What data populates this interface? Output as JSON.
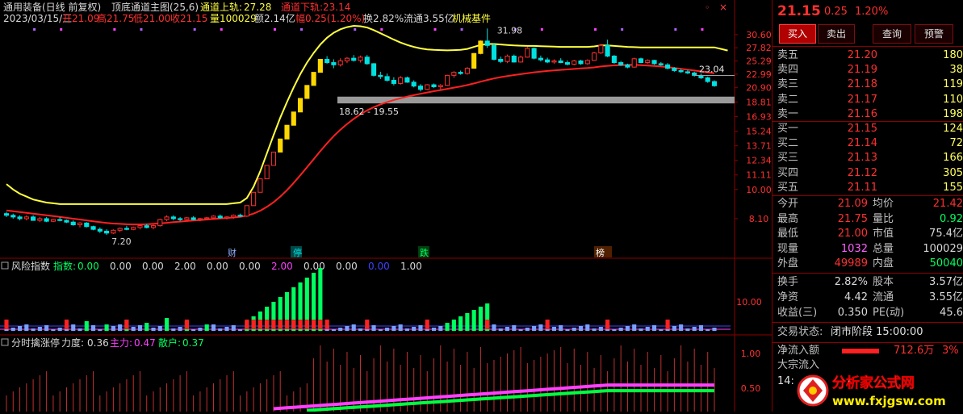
{
  "header": {
    "name": "通用装备(日线 前复权)",
    "indicator": "顶底通道主图(25,6)",
    "upper_label": "通道上轨:",
    "upper_val": "27.28",
    "lower_label": "通道下轨:",
    "lower_val": "23.14",
    "line2_date": "2023/03/15/三",
    "line2_open": "开21.09",
    "line2_high": "高21.75",
    "line2_low": "低21.00",
    "line2_close": "收21.15",
    "line2_vol": "量100029",
    "line2_amt": "额2.14亿",
    "line2_chg": "幅0.25(1.20%)",
    "line2_turn": "换2.82%",
    "line2_float": "流通3.55亿",
    "line2_sector": "机械基件"
  },
  "panel2": {
    "title": "风险指数",
    "idx_label": "指数:",
    "values": [
      "0.00",
      "0.00",
      "0.00",
      "2.00",
      "0.00",
      "0.00",
      "2.00",
      "0.00",
      "0.00",
      "0.00",
      "1.00"
    ],
    "axis_label": "10.00"
  },
  "panel3": {
    "title": "分时擒涨停",
    "force_label": "力度:",
    "force_val": "0.36",
    "main_label": "主力:",
    "main_val": "0.47",
    "retail_label": "散户:",
    "retail_val": "0.37",
    "axis": [
      "1.00",
      "0.50"
    ]
  },
  "chart_data": {
    "type": "candlestick",
    "y_axis_ticks": [
      "30.60",
      "27.82",
      "25.29",
      "22.99",
      "20.90",
      "18.81",
      "16.93",
      "15.24",
      "13.71",
      "12.34",
      "11.11",
      "10.00",
      "8.10"
    ],
    "annotations": {
      "peak": "31.98",
      "low": "7.20",
      "band": "18.62 - 19.55",
      "last": "23.04"
    },
    "markers": [
      "财",
      "停",
      "跌",
      "榜"
    ],
    "colors": {
      "up": "#ff3030",
      "down": "#00e0e0",
      "upper_channel": "#ffff40",
      "lower_channel": "#ff2020",
      "band": "#9a9a9a"
    },
    "candles": [
      [
        8.4,
        8.5,
        8.2,
        8.3
      ],
      [
        8.3,
        8.4,
        8.1,
        8.2
      ],
      [
        8.2,
        8.3,
        8.0,
        8.1
      ],
      [
        8.1,
        8.3,
        8.0,
        8.2
      ],
      [
        8.2,
        8.3,
        8.0,
        8.0
      ],
      [
        8.0,
        8.2,
        7.9,
        8.1
      ],
      [
        8.1,
        8.2,
        7.9,
        7.95
      ],
      [
        7.95,
        8.1,
        7.9,
        8.05
      ],
      [
        8.05,
        8.2,
        7.95,
        8.0
      ],
      [
        8.0,
        8.05,
        7.85,
        7.9
      ],
      [
        7.9,
        8.0,
        7.7,
        7.75
      ],
      [
        7.75,
        7.9,
        7.6,
        7.85
      ],
      [
        7.85,
        7.9,
        7.6,
        7.65
      ],
      [
        7.65,
        7.7,
        7.45,
        7.5
      ],
      [
        7.5,
        7.6,
        7.3,
        7.4
      ],
      [
        7.4,
        7.5,
        7.2,
        7.3
      ],
      [
        7.3,
        7.5,
        7.25,
        7.45
      ],
      [
        7.45,
        7.6,
        7.35,
        7.55
      ],
      [
        7.55,
        7.7,
        7.45,
        7.5
      ],
      [
        7.5,
        7.65,
        7.45,
        7.6
      ],
      [
        7.6,
        7.75,
        7.5,
        7.7
      ],
      [
        7.7,
        7.8,
        7.55,
        7.6
      ],
      [
        7.6,
        7.75,
        7.5,
        7.7
      ],
      [
        7.7,
        8.1,
        7.65,
        8.05
      ],
      [
        8.05,
        8.3,
        7.95,
        8.2
      ],
      [
        8.2,
        8.3,
        8.0,
        8.1
      ],
      [
        8.1,
        8.2,
        7.95,
        8.05
      ],
      [
        8.05,
        8.2,
        8.0,
        8.15
      ],
      [
        8.15,
        8.25,
        8.0,
        8.05
      ],
      [
        8.05,
        8.15,
        7.95,
        8.1
      ],
      [
        8.1,
        8.2,
        8.0,
        8.15
      ],
      [
        8.15,
        8.3,
        8.1,
        8.25
      ],
      [
        8.25,
        8.35,
        8.1,
        8.15
      ],
      [
        8.15,
        8.25,
        8.05,
        8.2
      ],
      [
        8.2,
        8.35,
        8.1,
        8.3
      ],
      [
        8.3,
        8.4,
        8.2,
        8.25
      ],
      [
        8.25,
        8.9,
        8.2,
        8.9
      ],
      [
        8.9,
        9.8,
        8.9,
        9.8
      ],
      [
        9.8,
        10.8,
        9.8,
        10.8
      ],
      [
        10.8,
        11.9,
        10.8,
        11.9
      ],
      [
        11.9,
        13.1,
        11.9,
        13.1
      ],
      [
        13.1,
        14.4,
        13.1,
        14.4
      ],
      [
        14.4,
        15.9,
        14.4,
        15.9
      ],
      [
        15.9,
        17.5,
        15.9,
        17.5
      ],
      [
        17.5,
        19.3,
        17.5,
        19.3
      ],
      [
        19.3,
        21.2,
        19.3,
        21.2
      ],
      [
        21.2,
        23.3,
        21.2,
        23.3
      ],
      [
        23.3,
        25.6,
        23.3,
        25.6
      ],
      [
        25.6,
        26.2,
        24.8,
        25.0
      ],
      [
        25.0,
        25.6,
        24.0,
        24.6
      ],
      [
        24.6,
        25.8,
        24.3,
        25.3
      ],
      [
        25.3,
        26.0,
        24.9,
        25.8
      ],
      [
        25.8,
        26.4,
        25.2,
        25.4
      ],
      [
        25.4,
        26.3,
        25.0,
        26.0
      ],
      [
        26.0,
        26.4,
        24.6,
        24.8
      ],
      [
        24.8,
        24.9,
        22.6,
        22.8
      ],
      [
        22.8,
        23.4,
        22.2,
        22.6
      ],
      [
        22.6,
        23.1,
        21.8,
        22.0
      ],
      [
        22.0,
        22.5,
        21.2,
        21.5
      ],
      [
        21.5,
        22.7,
        21.3,
        22.4
      ],
      [
        22.4,
        22.6,
        21.6,
        21.7
      ],
      [
        21.7,
        22.0,
        20.9,
        21.1
      ],
      [
        21.1,
        21.4,
        20.3,
        20.6
      ],
      [
        20.6,
        21.4,
        20.5,
        21.3
      ],
      [
        21.3,
        21.5,
        20.8,
        21.0
      ],
      [
        21.0,
        21.4,
        20.6,
        21.2
      ],
      [
        21.2,
        22.9,
        21.1,
        22.8
      ],
      [
        22.8,
        23.5,
        22.4,
        23.3
      ],
      [
        23.3,
        23.6,
        22.9,
        23.1
      ],
      [
        23.1,
        24.2,
        22.9,
        24.0
      ],
      [
        24.0,
        26.8,
        23.9,
        26.7
      ],
      [
        26.7,
        29.4,
        26.5,
        29.2
      ],
      [
        29.2,
        31.98,
        27.8,
        28.3
      ],
      [
        28.3,
        28.8,
        25.4,
        25.6
      ],
      [
        25.6,
        26.1,
        24.9,
        25.2
      ],
      [
        25.2,
        26.5,
        24.9,
        26.2
      ],
      [
        26.2,
        26.5,
        25.0,
        25.1
      ],
      [
        25.1,
        26.3,
        25.0,
        26.0
      ],
      [
        26.0,
        28.0,
        25.9,
        27.7
      ],
      [
        27.7,
        27.9,
        25.6,
        25.8
      ],
      [
        25.8,
        26.3,
        25.2,
        25.5
      ],
      [
        25.5,
        25.9,
        24.9,
        25.1
      ],
      [
        25.1,
        25.6,
        24.8,
        25.3
      ],
      [
        25.3,
        25.8,
        24.9,
        25.0
      ],
      [
        25.0,
        25.4,
        24.5,
        24.7
      ],
      [
        24.7,
        25.5,
        24.5,
        25.3
      ],
      [
        25.3,
        25.5,
        24.6,
        24.8
      ],
      [
        24.8,
        25.6,
        24.6,
        25.4
      ],
      [
        25.4,
        27.0,
        25.3,
        26.8
      ],
      [
        26.8,
        28.6,
        26.6,
        28.3
      ],
      [
        28.3,
        29.5,
        26.0,
        26.2
      ],
      [
        26.2,
        26.4,
        24.8,
        25.0
      ],
      [
        25.0,
        25.3,
        24.4,
        24.6
      ],
      [
        24.6,
        24.8,
        24.0,
        24.2
      ],
      [
        24.2,
        25.9,
        24.1,
        25.7
      ],
      [
        25.7,
        25.9,
        24.9,
        25.0
      ],
      [
        25.0,
        25.6,
        24.8,
        25.4
      ],
      [
        25.4,
        25.5,
        24.6,
        24.8
      ],
      [
        24.8,
        25.1,
        24.4,
        24.6
      ],
      [
        24.6,
        24.9,
        23.8,
        24.0
      ],
      [
        24.0,
        24.2,
        23.4,
        23.6
      ],
      [
        23.6,
        23.9,
        23.2,
        23.4
      ],
      [
        23.4,
        23.7,
        23.0,
        23.2
      ],
      [
        23.2,
        23.4,
        22.6,
        22.8
      ],
      [
        22.8,
        23.1,
        22.2,
        22.4
      ],
      [
        22.4,
        22.6,
        21.6,
        21.8
      ],
      [
        21.8,
        22.0,
        21.0,
        21.15
      ]
    ],
    "upper_channel": [
      10.4,
      10.0,
      9.7,
      9.5,
      9.3,
      9.2,
      9.1,
      9.05,
      9.0,
      9.0,
      9.0,
      9.0,
      9.0,
      9.0,
      9.0,
      9.0,
      9.0,
      9.0,
      9.0,
      9.0,
      9.0,
      9.0,
      9.0,
      9.0,
      9.0,
      9.0,
      9.0,
      9.0,
      9.0,
      9.0,
      9.0,
      9.0,
      9.0,
      9.0,
      9.05,
      9.1,
      9.4,
      10.2,
      11.4,
      13.0,
      14.8,
      16.8,
      18.8,
      20.9,
      23.0,
      25.0,
      26.8,
      28.5,
      29.9,
      31.0,
      31.8,
      32.3,
      32.6,
      32.5,
      32.2,
      31.6,
      30.9,
      30.2,
      29.5,
      28.9,
      28.4,
      28.0,
      27.7,
      27.5,
      27.4,
      27.35,
      27.3,
      27.35,
      27.4,
      27.6,
      28.0,
      28.4,
      28.6,
      28.6,
      28.5,
      28.4,
      28.3,
      28.25,
      28.2,
      28.2,
      28.15,
      28.1,
      28.05,
      28.0,
      28.0,
      28.0,
      28.0,
      28.0,
      28.1,
      28.3,
      28.3,
      28.2,
      28.1,
      28.0,
      27.95,
      27.9,
      27.9,
      27.9,
      27.9,
      27.9,
      27.9,
      27.9,
      27.9,
      27.9,
      27.9,
      27.9,
      27.9,
      27.6,
      27.28
    ],
    "lower_channel": [
      8.6,
      8.55,
      8.5,
      8.45,
      8.4,
      8.35,
      8.3,
      8.25,
      8.2,
      8.15,
      8.1,
      8.05,
      8.0,
      7.95,
      7.9,
      7.85,
      7.82,
      7.8,
      7.78,
      7.77,
      7.77,
      7.78,
      7.8,
      7.83,
      7.86,
      7.9,
      7.93,
      7.96,
      7.99,
      8.02,
      8.05,
      8.08,
      8.11,
      8.14,
      8.17,
      8.2,
      8.28,
      8.4,
      8.58,
      8.82,
      9.12,
      9.5,
      9.95,
      10.48,
      11.08,
      11.74,
      12.45,
      13.2,
      13.95,
      14.7,
      15.4,
      16.05,
      16.65,
      17.2,
      17.7,
      18.12,
      18.48,
      18.8,
      19.08,
      19.32,
      19.55,
      19.76,
      19.96,
      20.15,
      20.33,
      20.5,
      20.68,
      20.86,
      21.05,
      21.25,
      21.5,
      21.78,
      22.05,
      22.3,
      22.5,
      22.68,
      22.85,
      23.0,
      23.15,
      23.3,
      23.42,
      23.53,
      23.63,
      23.72,
      23.8,
      23.88,
      23.96,
      24.04,
      24.15,
      24.3,
      24.42,
      24.5,
      24.55,
      24.58,
      24.6,
      24.55,
      24.48,
      24.4,
      24.3,
      24.2,
      24.05,
      23.9,
      23.75,
      23.6,
      23.45,
      23.3,
      23.14
    ]
  }
}
